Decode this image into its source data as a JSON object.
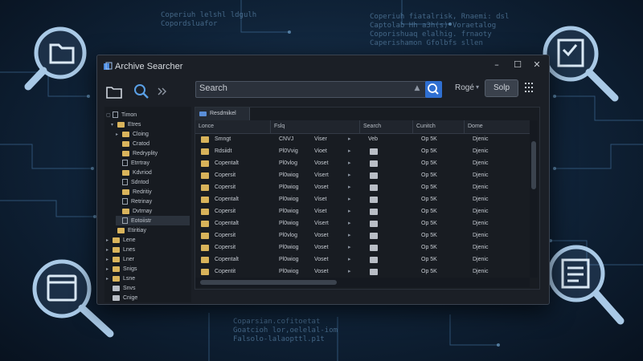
{
  "window": {
    "title": "Archive Searcher"
  },
  "controls": {
    "minimize": "–",
    "maximize": "☐",
    "close": "✕"
  },
  "toolbar": {
    "search_label": "Search",
    "sort_label": "Rogé",
    "save_label": "Solp"
  },
  "sidebar": {
    "items": [
      {
        "label": "Timon",
        "arrow": "▢",
        "icon": "file-icon",
        "indent": 0,
        "selected": false
      },
      {
        "label": "Etres",
        "arrow": "▾",
        "icon": "folder-icon",
        "indent": 1,
        "selected": false
      },
      {
        "label": "Cloing",
        "arrow": "▸",
        "icon": "folder-icon",
        "indent": 2,
        "selected": false
      },
      {
        "label": "Cratod",
        "arrow": "",
        "icon": "folder-icon",
        "indent": 2,
        "selected": false
      },
      {
        "label": "Redryplity",
        "arrow": "",
        "icon": "folder-icon",
        "indent": 2,
        "selected": false
      },
      {
        "label": "Etrrtray",
        "arrow": "",
        "icon": "file-icon",
        "indent": 2,
        "selected": false
      },
      {
        "label": "Kdvriod",
        "arrow": "",
        "icon": "folder-icon",
        "indent": 2,
        "selected": false
      },
      {
        "label": "Sdntod",
        "arrow": "",
        "icon": "file-icon",
        "indent": 2,
        "selected": false
      },
      {
        "label": "Redritiy",
        "arrow": "",
        "icon": "folder-icon",
        "indent": 2,
        "selected": false
      },
      {
        "label": "Retrinay",
        "arrow": "",
        "icon": "file-icon",
        "indent": 2,
        "selected": false
      },
      {
        "label": "Dvtrnay",
        "arrow": "",
        "icon": "folder-icon",
        "indent": 2,
        "selected": false
      },
      {
        "label": "Eotoiistr",
        "arrow": "",
        "icon": "file-icon",
        "indent": 2,
        "selected": true
      },
      {
        "label": "Etiritiay",
        "arrow": "",
        "icon": "folder-icon",
        "indent": 1,
        "selected": false
      },
      {
        "label": "Lene",
        "arrow": "▸",
        "icon": "folder-icon",
        "indent": 0,
        "selected": false
      },
      {
        "label": "Lnes",
        "arrow": "▸",
        "icon": "folder-icon",
        "indent": 0,
        "selected": false
      },
      {
        "label": "Lner",
        "arrow": "▸",
        "icon": "folder-icon",
        "indent": 0,
        "selected": false
      },
      {
        "label": "Snigs",
        "arrow": "▸",
        "icon": "folder-icon",
        "indent": 0,
        "selected": false
      },
      {
        "label": "Lsne",
        "arrow": "▸",
        "icon": "folder-icon",
        "indent": 0,
        "selected": false
      },
      {
        "label": "Snvs",
        "arrow": "",
        "icon": "grey-folder-icon",
        "indent": 0,
        "selected": false
      },
      {
        "label": "Cnige",
        "arrow": "",
        "icon": "grey-folder-icon",
        "indent": 0,
        "selected": false
      }
    ]
  },
  "main": {
    "tab_label": "Resdmikel",
    "columns": [
      "Lonce",
      "Fslq",
      "Search",
      "Cunitch",
      "Dome"
    ],
    "rows": [
      {
        "name": "Smngt",
        "a": "CNVJ",
        "b": "Viser",
        "type": "Veb",
        "size": "Op 5K",
        "date": "Djenic"
      },
      {
        "name": "Rdsiidt",
        "a": "Pl0Vvig",
        "b": "Vioet",
        "type": "",
        "size": "Op 5K",
        "date": "Djenic"
      },
      {
        "name": "Copentalt",
        "a": "Pl0vlog",
        "b": "Voset",
        "type": "",
        "size": "Op 5K",
        "date": "Djenic"
      },
      {
        "name": "Copersit",
        "a": "Pl0wiog",
        "b": "Visert",
        "type": "",
        "size": "Op 5K",
        "date": "Djenic"
      },
      {
        "name": "Copersit",
        "a": "Pl0wiog",
        "b": "Voset",
        "type": "",
        "size": "Op 5K",
        "date": "Djenic"
      },
      {
        "name": "Copentalt",
        "a": "Pl0wiog",
        "b": "Viset",
        "type": "",
        "size": "Op 5K",
        "date": "Djenic"
      },
      {
        "name": "Copersit",
        "a": "Pl0wiog",
        "b": "Viset",
        "type": "",
        "size": "Op 5K",
        "date": "Djenic"
      },
      {
        "name": "Copentalt",
        "a": "Pl0wiog",
        "b": "Visert",
        "type": "",
        "size": "Op 5K",
        "date": "Djenic"
      },
      {
        "name": "Copersit",
        "a": "Pl0vlog",
        "b": "Voset",
        "type": "",
        "size": "Op 5K",
        "date": "Djenic"
      },
      {
        "name": "Copersit",
        "a": "Pl0wiog",
        "b": "Voset",
        "type": "",
        "size": "Op 5K",
        "date": "Djenic"
      },
      {
        "name": "Copentalt",
        "a": "Pl0wiog",
        "b": "Voset",
        "type": "",
        "size": "Op 5K",
        "date": "Djenic"
      },
      {
        "name": "Copentit",
        "a": "Pl0wiog",
        "b": "Voset",
        "type": "",
        "size": "Op 5K",
        "date": "Djenic"
      }
    ]
  },
  "background_text": [
    "Coperiuh fiatalrisk, Rnaemi: dsl\nCaptolab Hh a3h(s) Voraetalog\nCoporishuaq elalhig. frnaoty\nCaperishamon Gfolbfs sllen",
    "Coperiuh lelshl ldgulh\nCopordsluafor",
    "Coparsian.cofitoetat\nGoatcioh lor,oelelal-iom\nFalsolo-lalaopttl.p1t"
  ],
  "colors": {
    "accent": "#2f6fd1",
    "folder": "#d8b35a",
    "window_bg": "#1b1f26"
  }
}
